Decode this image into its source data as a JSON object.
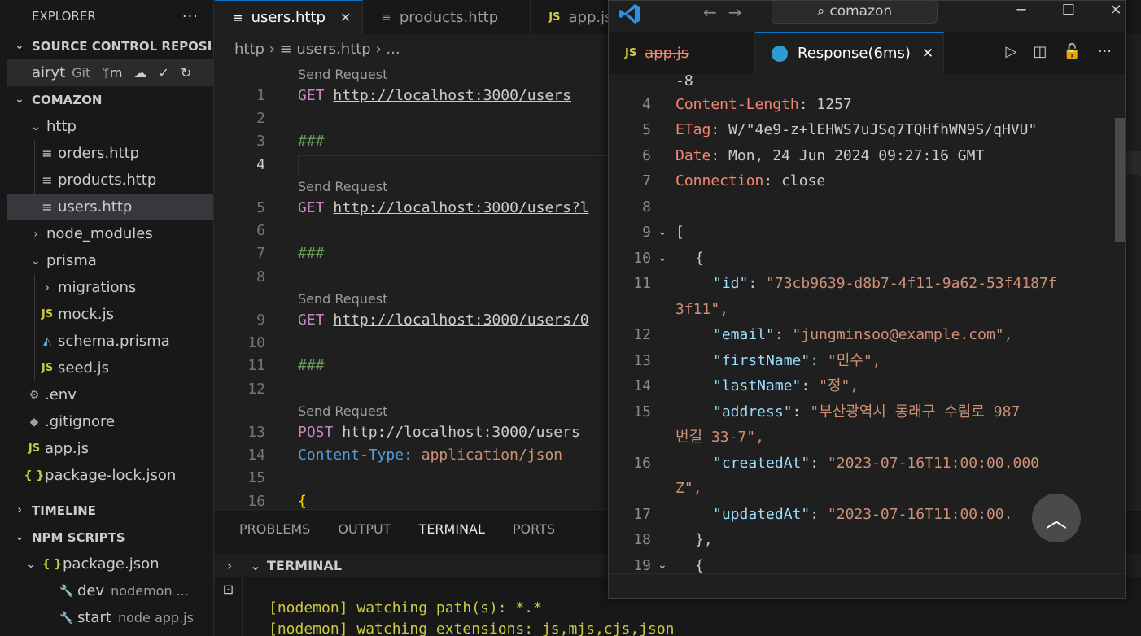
{
  "sidebar": {
    "title": "EXPLORER",
    "more": "···",
    "scm_section": "SOURCE CONTROL REPOSI...",
    "scm_repo": "airyt",
    "scm_type": "Git",
    "scm_branch": "ᛘm",
    "project": "COMAZON",
    "tree": [
      {
        "label": "http",
        "icon": "chevron-down",
        "depth": 0
      },
      {
        "label": "orders.http",
        "icon": "file",
        "depth": 1
      },
      {
        "label": "products.http",
        "icon": "file",
        "depth": 1
      },
      {
        "label": "users.http",
        "icon": "file",
        "depth": 1,
        "selected": true
      },
      {
        "label": "node_modules",
        "icon": "chevron-right",
        "depth": 0
      },
      {
        "label": "prisma",
        "icon": "chevron-down",
        "depth": 0
      },
      {
        "label": "migrations",
        "icon": "chevron-right",
        "depth": 1
      },
      {
        "label": "mock.js",
        "icon": "js",
        "depth": 1
      },
      {
        "label": "schema.prisma",
        "icon": "prisma",
        "depth": 1
      },
      {
        "label": "seed.js",
        "icon": "js",
        "depth": 1
      },
      {
        "label": ".env",
        "icon": "gear",
        "depth": 0
      },
      {
        "label": ".gitignore",
        "icon": "git",
        "depth": 0
      },
      {
        "label": "app.js",
        "icon": "js",
        "depth": 0
      },
      {
        "label": "package-lock.json",
        "icon": "json",
        "depth": 0
      }
    ],
    "timeline": "TIMELINE",
    "npm_scripts": "NPM SCRIPTS",
    "npm_package": "package.json",
    "npm_items": [
      {
        "name": "dev",
        "cmd": "nodemon ..."
      },
      {
        "name": "start",
        "cmd": "node app.js"
      }
    ]
  },
  "tabs": [
    {
      "label": "users.http",
      "active": true
    },
    {
      "label": "products.http"
    },
    {
      "label": "app.js"
    }
  ],
  "breadcrumb": {
    "folder": "http",
    "file": "users.http",
    "more": "..."
  },
  "code": {
    "lens": "Send Request",
    "l1": {
      "n": "1",
      "method": "GET",
      "url": "http://localhost:3000/users"
    },
    "l2": {
      "n": "2"
    },
    "l3": {
      "n": "3",
      "text": "###"
    },
    "l4": {
      "n": "4"
    },
    "l5": {
      "n": "5",
      "method": "GET",
      "url": "http://localhost:3000/users?l"
    },
    "l6": {
      "n": "6"
    },
    "l7": {
      "n": "7",
      "text": "###"
    },
    "l8": {
      "n": "8"
    },
    "l9": {
      "n": "9",
      "method": "GET",
      "url": "http://localhost:3000/users/0"
    },
    "l10": {
      "n": "10"
    },
    "l11": {
      "n": "11",
      "text": "###"
    },
    "l12": {
      "n": "12"
    },
    "l13": {
      "n": "13",
      "method": "POST",
      "url": "http://localhost:3000/users"
    },
    "l14": {
      "n": "14",
      "key": "Content-Type:",
      "value": "application/json"
    },
    "l15": {
      "n": "15"
    },
    "l16": {
      "n": "16",
      "text": "{"
    }
  },
  "panel": {
    "tabs": [
      "PROBLEMS",
      "OUTPUT",
      "TERMINAL",
      "PORTS"
    ],
    "active_tab": "TERMINAL",
    "terminal_title": "TERMINAL",
    "lines": [
      "[nodemon] watching path(s): *.*",
      "[nodemon] watching extensions: js,mjs,cjs,json"
    ]
  },
  "response_window": {
    "search": "comazon",
    "tabs": [
      {
        "label": "app.js",
        "icon": "JS"
      },
      {
        "label": "Response(6ms)",
        "active": true
      }
    ],
    "lines": {
      "top": "-8",
      "l4": {
        "n": "4",
        "key": "Content-Length",
        "val": "1257"
      },
      "l5": {
        "n": "5",
        "key": "ETag",
        "val": "W/\"4e9-z+lEHWS7uJSq7TQHfhWN9S/qHVU\""
      },
      "l6": {
        "n": "6",
        "key": "Date",
        "val": "Mon, 24 Jun 2024 09:27:16 GMT"
      },
      "l7": {
        "n": "7",
        "key": "Connection",
        "val": "close"
      },
      "l8": {
        "n": "8"
      },
      "l9": {
        "n": "9",
        "text": "["
      },
      "l10": {
        "n": "10",
        "text": "{"
      },
      "l11": {
        "n": "11",
        "key": "\"id\"",
        "val": "\"73cb9639-d8b7-4f11-9a62-53f4187f",
        "wrap": "3f11\","
      },
      "l12": {
        "n": "12",
        "key": "\"email\"",
        "val": "\"jungminsoo@example.com\","
      },
      "l13": {
        "n": "13",
        "key": "\"firstName\"",
        "val": "\"민수\","
      },
      "l14": {
        "n": "14",
        "key": "\"lastName\"",
        "val": "\"정\","
      },
      "l15": {
        "n": "15",
        "key": "\"address\"",
        "val": "\"부산광역시 동래구 수림로 987",
        "wrap": "번길 33-7\","
      },
      "l16": {
        "n": "16",
        "key": "\"createdAt\"",
        "val": "\"2023-07-16T11:00:00.000",
        "wrap": "Z\","
      },
      "l17": {
        "n": "17",
        "key": "\"updatedAt\"",
        "val": "\"2023-07-16T11:00:00."
      },
      "l18": {
        "n": "18",
        "text": "},"
      },
      "l19": {
        "n": "19",
        "text": "{"
      }
    }
  },
  "colors": {
    "accent": "#0078d4",
    "string": "#ce9178",
    "key": "#9cdcfe",
    "header": "#f48771"
  }
}
